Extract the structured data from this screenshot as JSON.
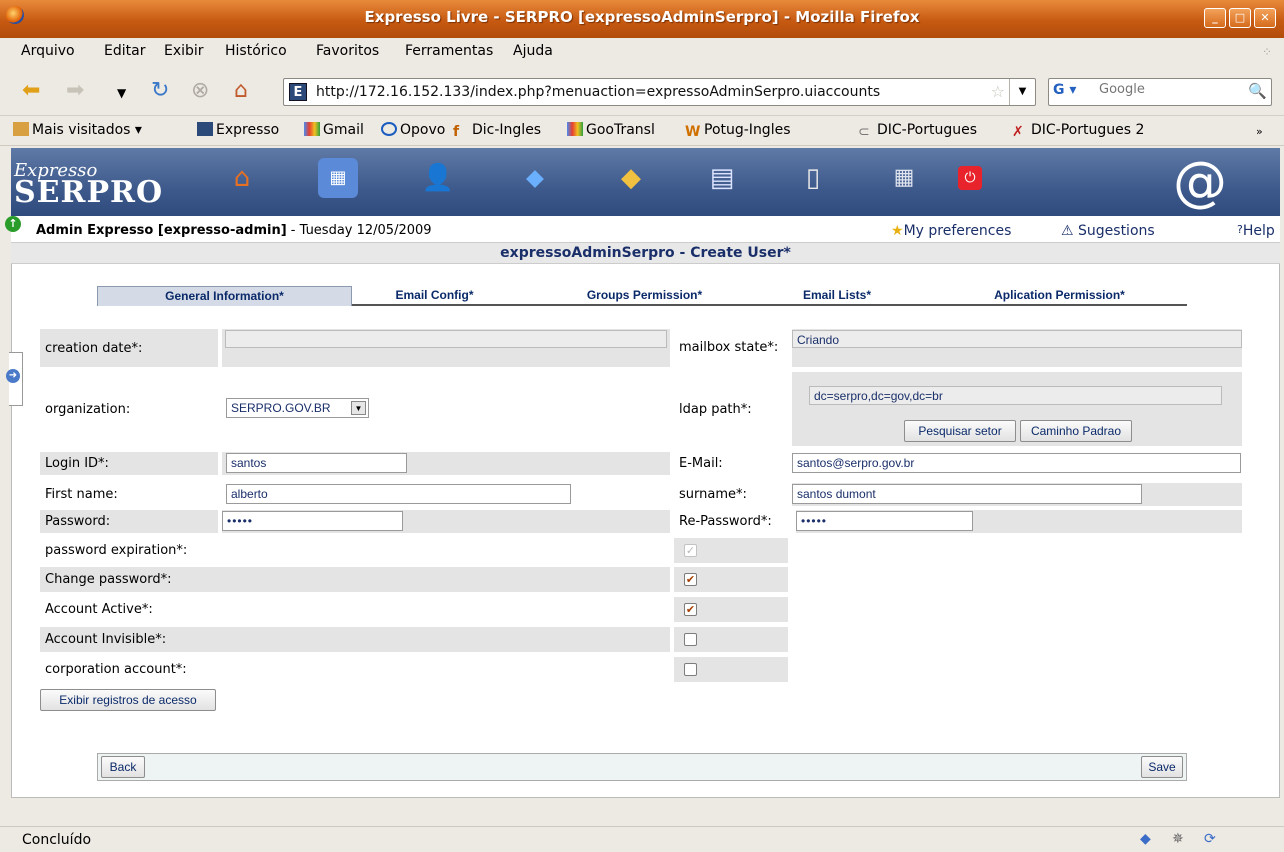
{
  "window": {
    "title": "Expresso Livre - SERPRO [expressoAdminSerpro] - Mozilla Firefox"
  },
  "menu": [
    "Arquivo",
    "Editar",
    "Exibir",
    "Histórico",
    "Favoritos",
    "Ferramentas",
    "Ajuda"
  ],
  "url": "http://172.16.152.133/index.php?menuaction=expressoAdminSerpro.uiaccounts",
  "search": {
    "placeholder": "Google",
    "engine": "G"
  },
  "bookmarks": [
    "Mais visitados",
    "Expresso",
    "Gmail",
    "Opovo",
    "Dic-Ingles",
    "GooTransl",
    "Potug-Ingles",
    "DIC-Portugues",
    "DIC-Portugues 2"
  ],
  "logo": {
    "line1": "Expresso",
    "line2": "SERPRO"
  },
  "status_row": {
    "admin_title": "Admin Expresso [expresso-admin]",
    "date": " - Tuesday 12/05/2009",
    "preferences": "My preferences",
    "suggestions": "Sugestions",
    "help": "Help"
  },
  "page_title": "expressoAdminSerpro - Create User*",
  "tabs": [
    "General Information*",
    "Email Config*",
    "Groups Permission*",
    "Email Lists*",
    "Aplication Permission*"
  ],
  "form": {
    "creation_date": {
      "label": "creation date*:",
      "value": ""
    },
    "mailbox_state": {
      "label": "mailbox state*:",
      "value": "Criando"
    },
    "organization": {
      "label": "organization:",
      "value": "SERPRO.GOV.BR"
    },
    "ldap_path": {
      "label": "ldap path*:",
      "value": "dc=serpro,dc=gov,dc=br"
    },
    "search_sector_btn": "Pesquisar setor",
    "default_path_btn": "Caminho Padrao",
    "login_id": {
      "label": "Login ID*:",
      "value": "santos"
    },
    "email": {
      "label": "E-Mail:",
      "value": "santos@serpro.gov.br"
    },
    "first_name": {
      "label": "First name:",
      "value": "alberto"
    },
    "surname": {
      "label": "surname*:",
      "value": "santos dumont"
    },
    "password": {
      "label": "Password:",
      "value": "•••••"
    },
    "re_password": {
      "label": "Re-Password*:",
      "value": "•••••"
    },
    "password_expiration": {
      "label": "password expiration*:",
      "checked": true,
      "disabled": true
    },
    "change_password": {
      "label": "Change password*:",
      "checked": true
    },
    "account_active": {
      "label": "Account Active*:",
      "checked": true
    },
    "account_invisible": {
      "label": "Account Invisible*:",
      "checked": false
    },
    "corporation_account": {
      "label": "corporation account*:",
      "checked": false
    },
    "access_log_btn": "Exibir registros de acesso"
  },
  "bottom": {
    "back": "Back",
    "save": "Save"
  },
  "statusbar": {
    "text": "Concluído"
  }
}
